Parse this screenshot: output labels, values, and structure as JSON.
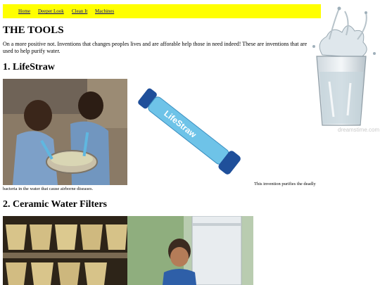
{
  "nav": {
    "items": [
      {
        "label": "Home"
      },
      {
        "label": "Deeper Look"
      },
      {
        "label": "Clean It"
      },
      {
        "label": "Machines"
      }
    ]
  },
  "page": {
    "title": "THE TOOLS",
    "intro": "On a more positive not. Inventions that changes peoples lives and are afforable help those in need indeed! These are inventions that are used to help purify water."
  },
  "sections": [
    {
      "heading": "1. LifeStraw",
      "caption_right": "This invention purifies the deadly",
      "caption_left": "bacteria in the water that cause airborne diseases.",
      "product_text": "LifeStraw"
    },
    {
      "heading": "2. Ceramic Water Filters"
    }
  ],
  "decor": {
    "watermark": "dreamstime.com"
  },
  "colors": {
    "nav_bg": "#ffff00",
    "link": "#000080",
    "straw": "#6ec3e8",
    "straw_cap": "#1f4f9a"
  }
}
